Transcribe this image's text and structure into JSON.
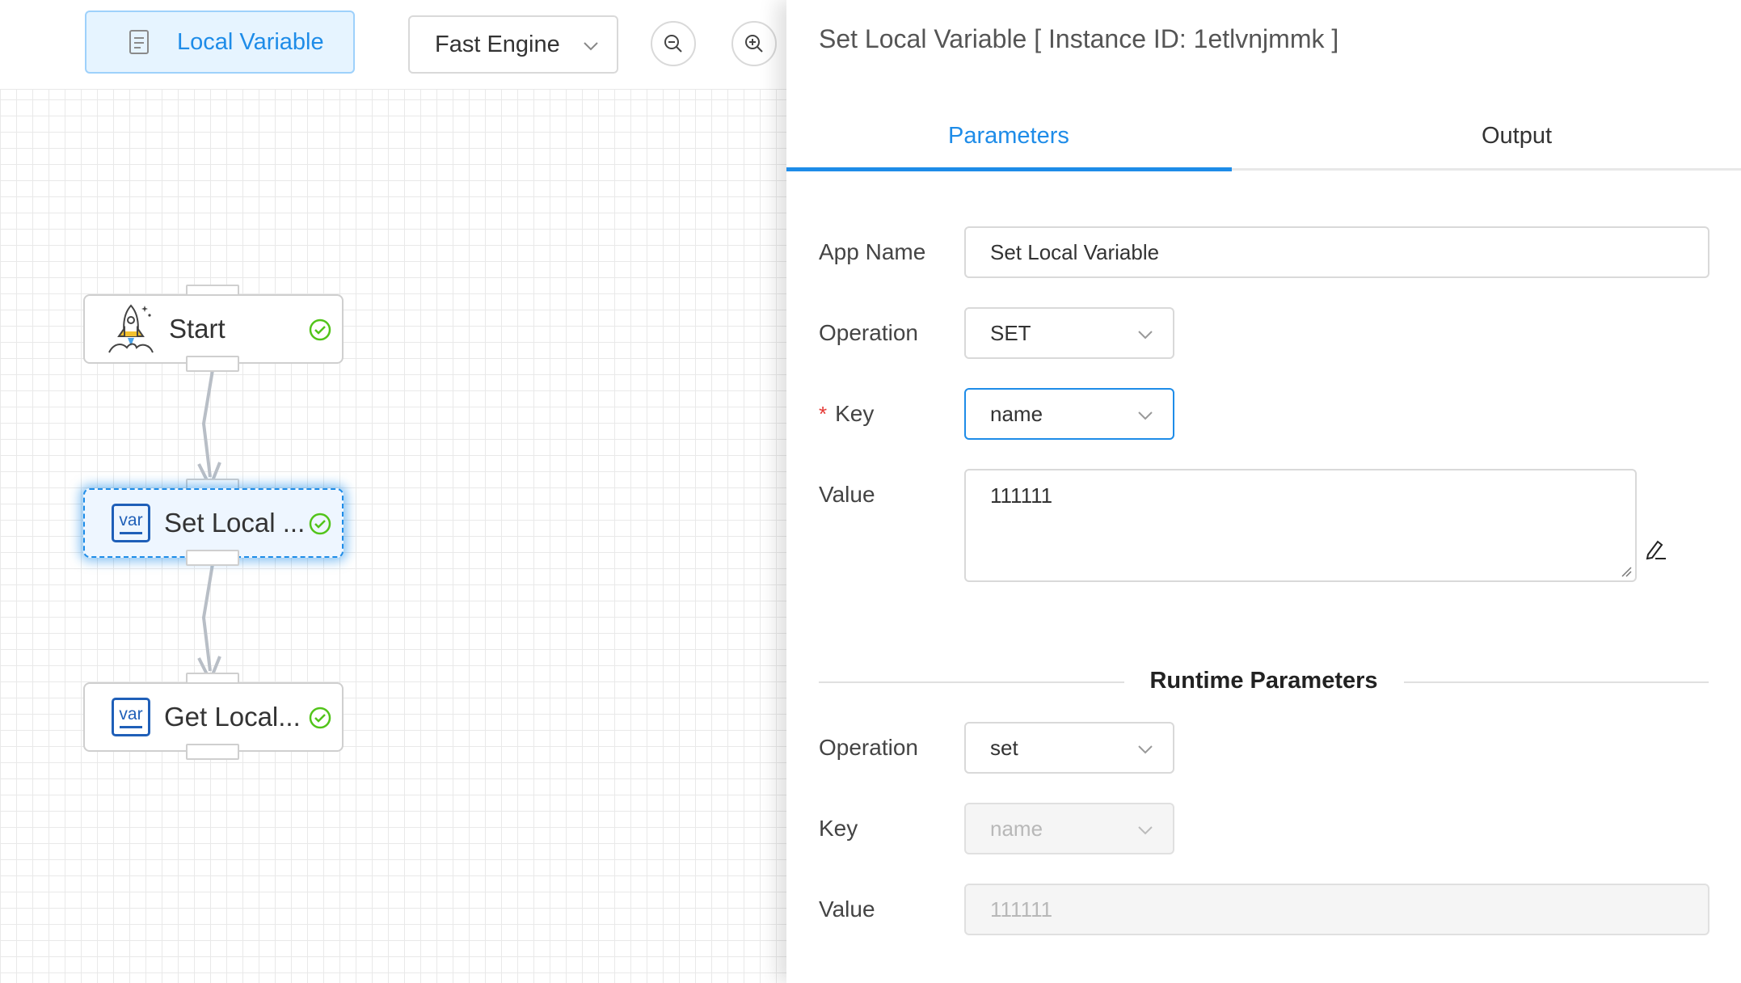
{
  "toolbar": {
    "local_variable_label": "Local Variable",
    "engine_select_value": "Fast Engine"
  },
  "nodes": [
    {
      "title": "Start",
      "status": "success"
    },
    {
      "title": "Set Local ...",
      "status": "success",
      "selected": true
    },
    {
      "title": "Get Local...",
      "status": "success"
    }
  ],
  "panel": {
    "title": "Set Local Variable [ Instance ID: 1etlvnjmmk ]",
    "tabs": [
      {
        "label": "Parameters",
        "active": true
      },
      {
        "label": "Output",
        "active": false
      }
    ],
    "parameters": {
      "app_name_label": "App Name",
      "app_name_value": "Set Local Variable",
      "operation_label": "Operation",
      "operation_value": "SET",
      "key_required_mark": "*",
      "key_label": "Key",
      "key_value": "name",
      "value_label": "Value",
      "value_value": "111111"
    },
    "runtime": {
      "title": "Runtime Parameters",
      "operation_label": "Operation",
      "operation_value": "set",
      "key_label": "Key",
      "key_value": "name",
      "value_label": "Value",
      "value_value": "111111"
    }
  },
  "colors": {
    "accent": "#1e8ce8",
    "success": "#52c41a",
    "required": "#e53935"
  },
  "icons": [
    "document-icon",
    "chevron-down-icon",
    "zoom-out-icon",
    "zoom-in-icon",
    "rocket-icon",
    "var-icon",
    "check-circle-icon",
    "edit-pencil-icon",
    "resize-handle-icon"
  ]
}
